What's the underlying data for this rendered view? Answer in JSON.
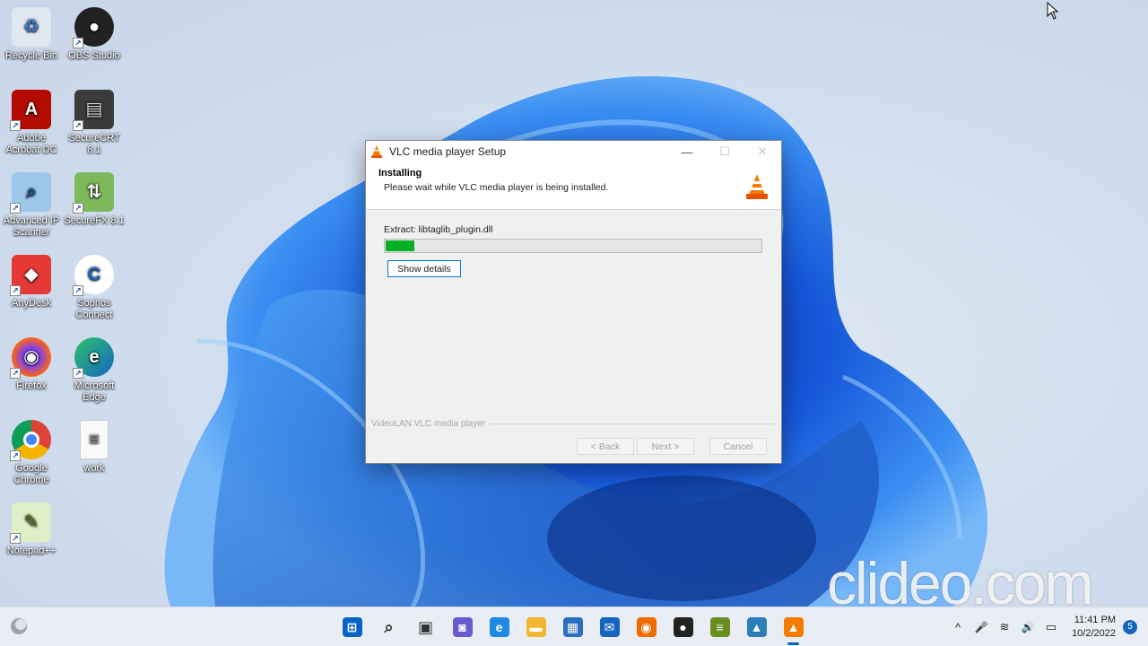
{
  "desktop": {
    "icons": [
      {
        "label": "Recycle Bin",
        "glyph": "♻"
      },
      {
        "label": "OBS Studio",
        "glyph": "●"
      },
      {
        "label": "Adobe Acrobat DC",
        "glyph": "A"
      },
      {
        "label": "SecureCRT 8.1",
        "glyph": "▤"
      },
      {
        "label": "Advanced IP Scanner",
        "glyph": "⌕"
      },
      {
        "label": "SecureFX 8.1",
        "glyph": "⇅"
      },
      {
        "label": "AnyDesk",
        "glyph": "◆"
      },
      {
        "label": "Sophos Connect",
        "glyph": "C"
      },
      {
        "label": "Firefox",
        "glyph": "◉"
      },
      {
        "label": "Microsoft Edge",
        "glyph": "e"
      },
      {
        "label": "Google Chrome",
        "glyph": "◍"
      },
      {
        "label": "work",
        "glyph": "≡"
      },
      {
        "label": "Notepad++",
        "glyph": "✎"
      }
    ]
  },
  "window": {
    "title": "VLC media player Setup",
    "minimize": "—",
    "maximize": "☐",
    "close": "✕",
    "header_title": "Installing",
    "header_subtitle": "Please wait while VLC media player is being installed.",
    "extract_text": "Extract: libtaglib_plugin.dll",
    "progress": 0.075,
    "show_details": "Show details",
    "branding": "VideoLAN VLC media player",
    "back": "< Back",
    "next": "Next >",
    "cancel": "Cancel"
  },
  "watermark": "clideo.com",
  "taskbar": {
    "apps": [
      {
        "name": "start",
        "glyph": "⊞",
        "color": "#0a64c8",
        "active": false
      },
      {
        "name": "search",
        "glyph": "⌕",
        "color": "#333333",
        "active": false
      },
      {
        "name": "task-view",
        "glyph": "▣",
        "color": "#333333",
        "active": false
      },
      {
        "name": "chat",
        "glyph": "◙",
        "color": "#6a5acd",
        "active": false
      },
      {
        "name": "edge",
        "glyph": "e",
        "color": "#1e88e5",
        "active": false
      },
      {
        "name": "file-explorer",
        "glyph": "▬",
        "color": "#f2b630",
        "active": false
      },
      {
        "name": "store",
        "glyph": "▦",
        "color": "#2c6fbf",
        "active": false
      },
      {
        "name": "mail",
        "glyph": "✉",
        "color": "#1565c0",
        "active": false
      },
      {
        "name": "firefox",
        "glyph": "◉",
        "color": "#ef6c00",
        "active": false
      },
      {
        "name": "obs",
        "glyph": "●",
        "color": "#222222",
        "active": false
      },
      {
        "name": "notepad",
        "glyph": "≡",
        "color": "#6b8e23",
        "active": false
      },
      {
        "name": "photos",
        "glyph": "▲",
        "color": "#2a7fb8",
        "active": false
      },
      {
        "name": "vlc",
        "glyph": "▲",
        "color": "#f57c00",
        "active": true
      }
    ],
    "tray": {
      "chevron": "^",
      "mic": "🎤",
      "wifi": "≋",
      "volume": "🔊",
      "battery": "▭",
      "time": "11:41 PM",
      "date": "10/2/2022",
      "notifications": "5"
    }
  }
}
